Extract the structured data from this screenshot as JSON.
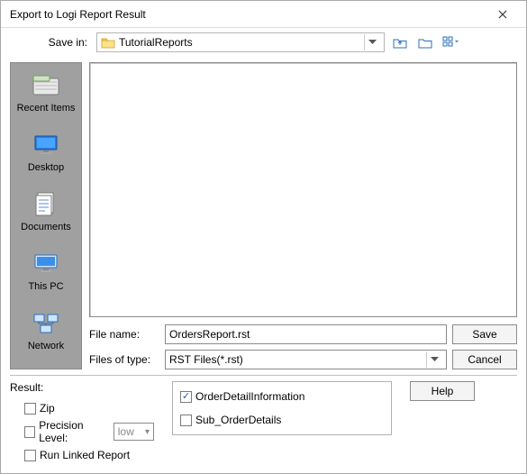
{
  "window": {
    "title": "Export to Logi Report Result"
  },
  "savein": {
    "label": "Save in:",
    "folder": "TutorialReports"
  },
  "sidebar": {
    "items": [
      {
        "label": "Recent Items"
      },
      {
        "label": "Desktop"
      },
      {
        "label": "Documents"
      },
      {
        "label": "This PC"
      },
      {
        "label": "Network"
      }
    ]
  },
  "fields": {
    "filename_label": "File name:",
    "filename_value": "OrdersReport.rst",
    "filetype_label": "Files of type:",
    "filetype_value": "RST Files(*.rst)"
  },
  "buttons": {
    "save": "Save",
    "cancel": "Cancel",
    "help": "Help"
  },
  "result": {
    "header": "Result:",
    "zip": "Zip",
    "precision": "Precision Level:",
    "precision_value": "low",
    "run_linked": "Run Linked Report",
    "detail1": "OrderDetailInformation",
    "detail1_checked": true,
    "detail2": "Sub_OrderDetails",
    "detail2_checked": false
  }
}
